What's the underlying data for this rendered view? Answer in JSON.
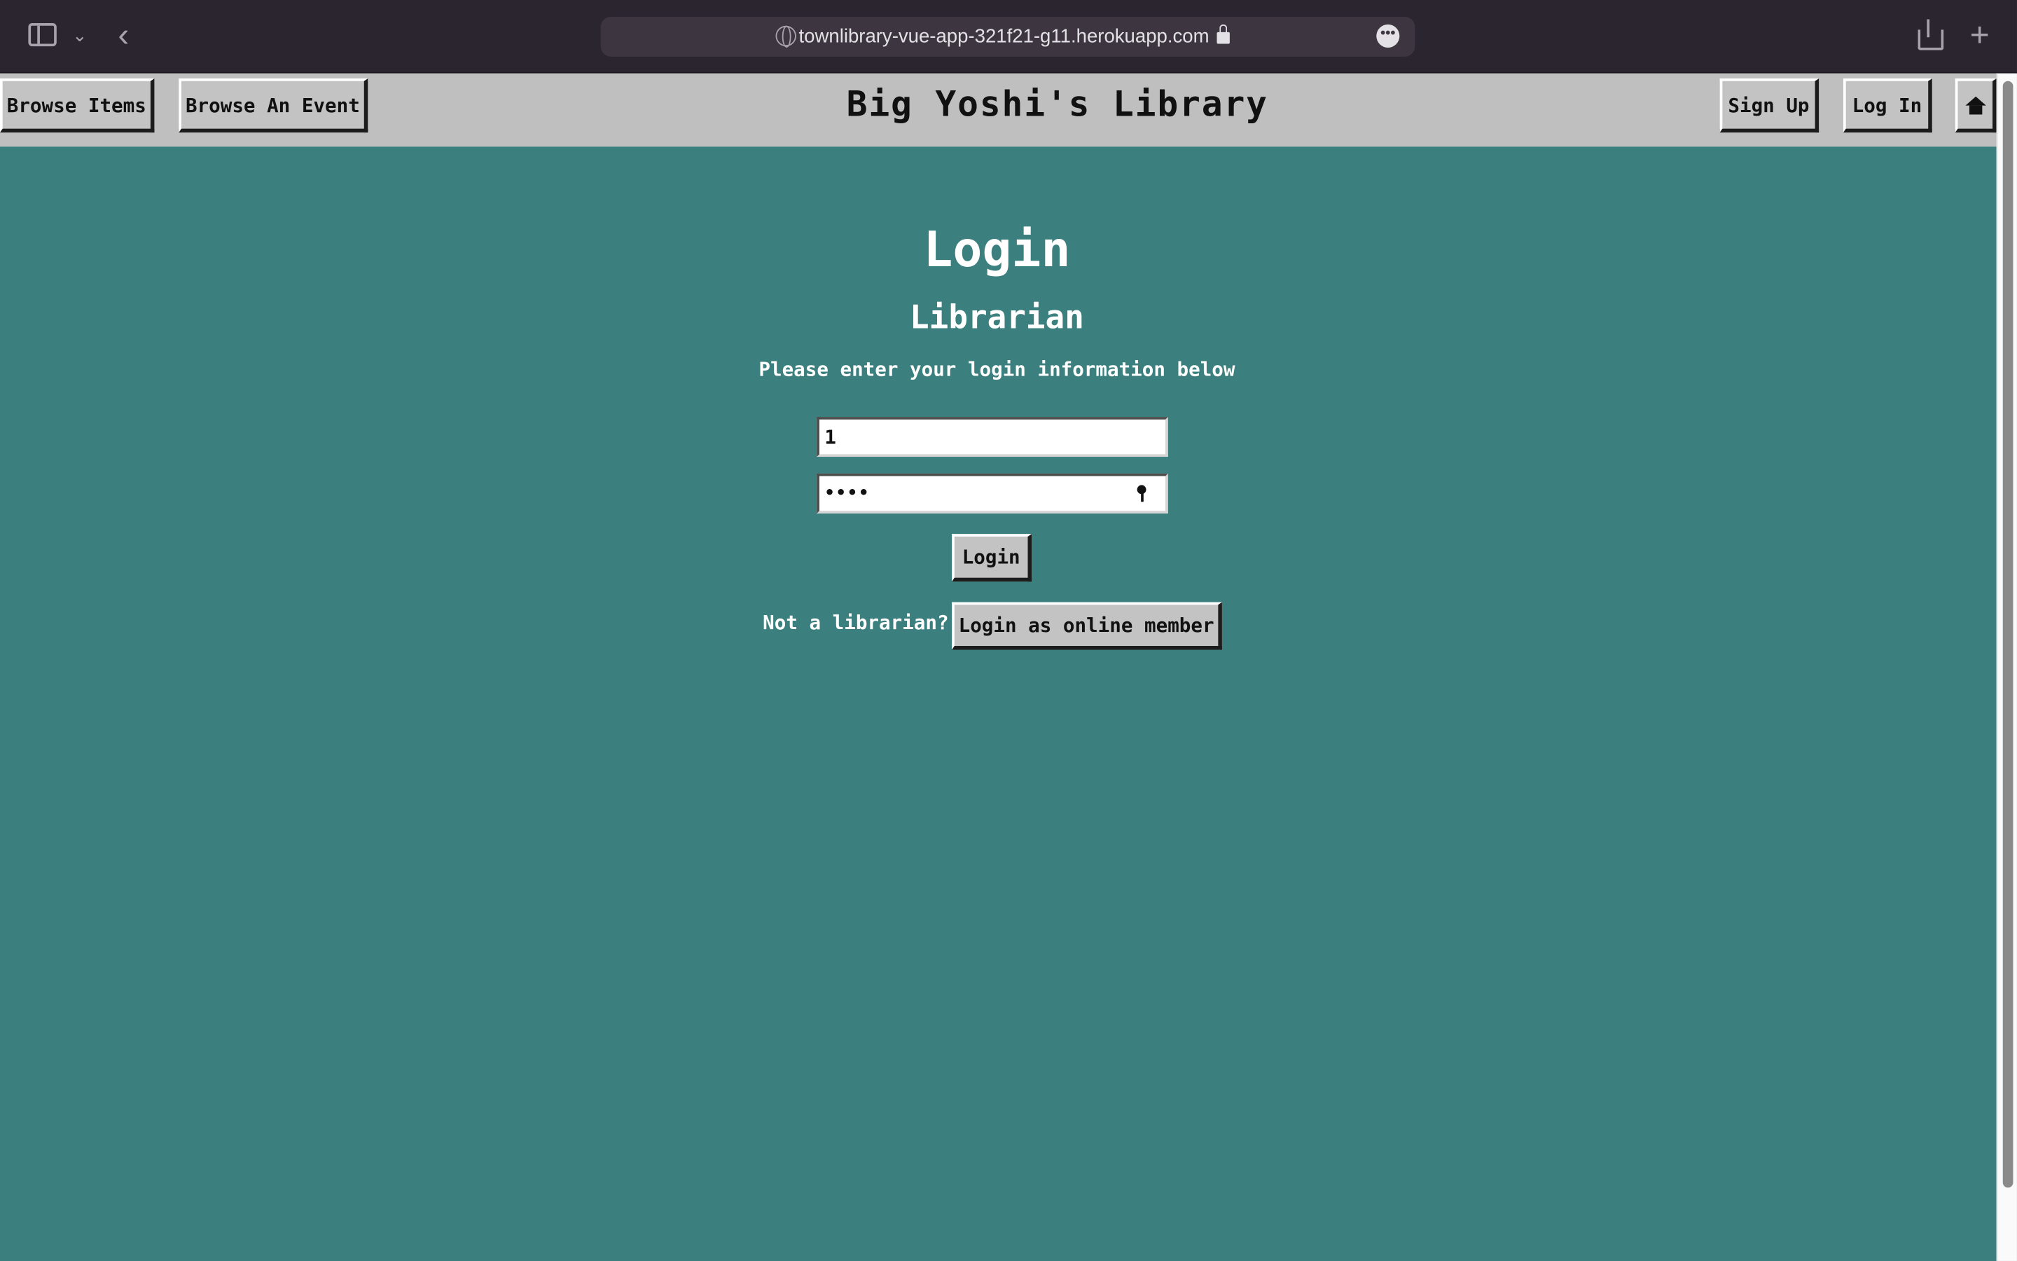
{
  "browser": {
    "url": "townlibrary-vue-app-321f21-g11.herokuapp.com",
    "more_glyph": "•••"
  },
  "nav": {
    "browse_items": "Browse Items",
    "browse_event": "Browse An Event",
    "title": "Big Yoshi's Library",
    "sign_up": "Sign Up",
    "log_in": "Log In",
    "home_icon": "home-icon"
  },
  "main": {
    "heading": "Login",
    "subheading": "Librarian",
    "instructions": "Please enter your login information below",
    "id_value": "1",
    "password_mask": "••••",
    "login_button": "Login",
    "not_librarian": "Not a librarian?",
    "member_button": "Login as online member"
  },
  "colors": {
    "background": "#3b807f",
    "navbar": "#bfbfbf",
    "button": "#c3c3c3"
  }
}
